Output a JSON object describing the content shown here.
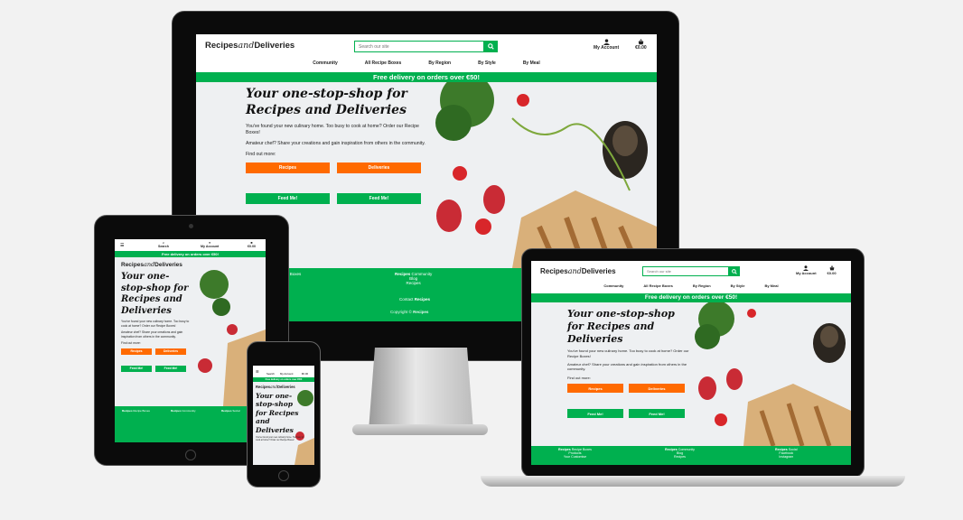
{
  "brand": {
    "name_part1": "Recipes",
    "name_part2": "and",
    "name_part3": "Deliveries"
  },
  "header": {
    "search_placeholder": "Search our site",
    "search_label": "Search",
    "account_label": "My Account",
    "bag_total": "€0.00"
  },
  "nav": [
    "Community",
    "All Recipe Boxes",
    "By Region",
    "By Style",
    "By Meal"
  ],
  "banner": "Free delivery on orders over €50!",
  "hero": {
    "title": "Your one-stop-shop for Recipes and Deliveries",
    "p1": "You've found your new culinary home. Too busy to cook at home? Order our Recipe Boxes!",
    "p2": "Amateur chef? Share your creations and gain inspiration from others in the community.",
    "p3": "Find out more:",
    "btn_recipes": "Recipes",
    "btn_deliveries": "Deliveries",
    "btn_feed": "Feed Me!"
  },
  "footer": {
    "col1_title": "Recipe Boxes",
    "col1_items": [
      "Products",
      "Your Customise"
    ],
    "col2_title": "Community",
    "col2_items": [
      "Blog",
      "Recipes"
    ],
    "col3_title": "Social",
    "col3_items": [
      "Facebook",
      "Instagram"
    ],
    "contact": "Contact",
    "copyright": "Copyright ©"
  },
  "colors": {
    "green": "#00b04f",
    "orange": "#ff6a00"
  }
}
